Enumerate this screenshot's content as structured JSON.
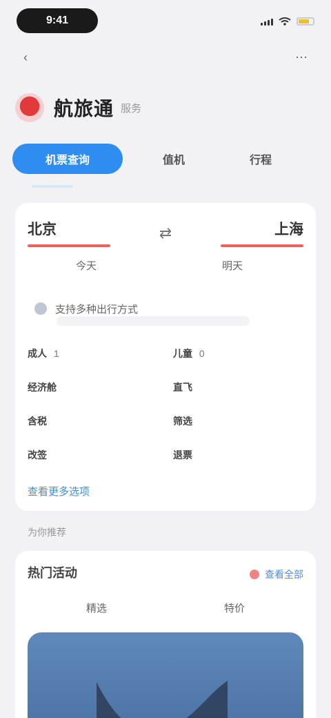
{
  "status_bar": {
    "time": "9:41"
  },
  "header": {
    "title": "航旅通",
    "subtitle": "服务"
  },
  "tabs": [
    {
      "label": "机票查询"
    },
    {
      "label": "值机"
    },
    {
      "label": "行程"
    }
  ],
  "route": {
    "from": "北京",
    "to": "上海",
    "date_left": "今天",
    "date_right": "明天"
  },
  "notice": {
    "text": "支持多种出行方式"
  },
  "details": [
    {
      "label": "成人",
      "value": "1"
    },
    {
      "label": "儿童",
      "value": "0"
    },
    {
      "label": "经济舱",
      "value": ""
    },
    {
      "label": "直飞",
      "value": ""
    },
    {
      "label": "含税",
      "value": ""
    },
    {
      "label": "筛选",
      "value": ""
    },
    {
      "label": "改签",
      "value": ""
    },
    {
      "label": "退票",
      "value": ""
    }
  ],
  "card_link": "查看更多选项",
  "section_label": "为你推荐",
  "card2": {
    "title": "热门活动",
    "more": "查看全部",
    "tabs": [
      {
        "label": "精选"
      },
      {
        "label": "特价"
      }
    ]
  },
  "colors": {
    "primary": "#2f8cf0",
    "accent_red": "#e23a3a",
    "banner": "#5f89ba",
    "background": "#f2f2f6"
  }
}
